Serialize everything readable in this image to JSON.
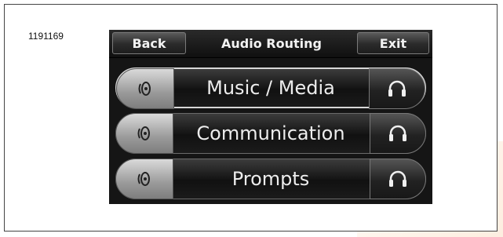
{
  "figure_id": "1191169",
  "header": {
    "back_label": "Back",
    "title": "Audio Routing",
    "exit_label": "Exit"
  },
  "routes": [
    {
      "label": "Music / Media",
      "speaker_icon": "speaker-icon",
      "headphone_icon": "headphones-icon",
      "selected": true
    },
    {
      "label": "Communication",
      "speaker_icon": "speaker-icon",
      "headphone_icon": "headphones-icon",
      "selected": false
    },
    {
      "label": "Prompts",
      "speaker_icon": "speaker-icon",
      "headphone_icon": "headphones-icon",
      "selected": false
    }
  ],
  "colors": {
    "screen_bg": "#151515",
    "text": "#ededed",
    "speaker_button": "#b0b0b0"
  }
}
